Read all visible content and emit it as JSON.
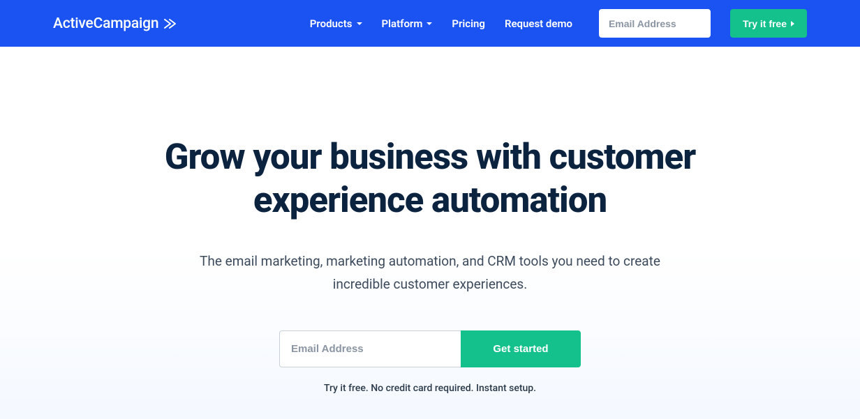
{
  "header": {
    "logo_text": "ActiveCampaign",
    "nav": {
      "products": "Products",
      "platform": "Platform",
      "pricing": "Pricing",
      "request_demo": "Request demo"
    },
    "email_placeholder": "Email Address",
    "try_free_label": "Try it free"
  },
  "hero": {
    "title": "Grow your business with customer experience automation",
    "subtitle": "The email marketing, marketing automation, and CRM tools you need to create incredible customer experiences.",
    "email_placeholder": "Email Address",
    "cta_label": "Get started",
    "disclaimer": "Try it free. No credit card required. Instant setup."
  }
}
